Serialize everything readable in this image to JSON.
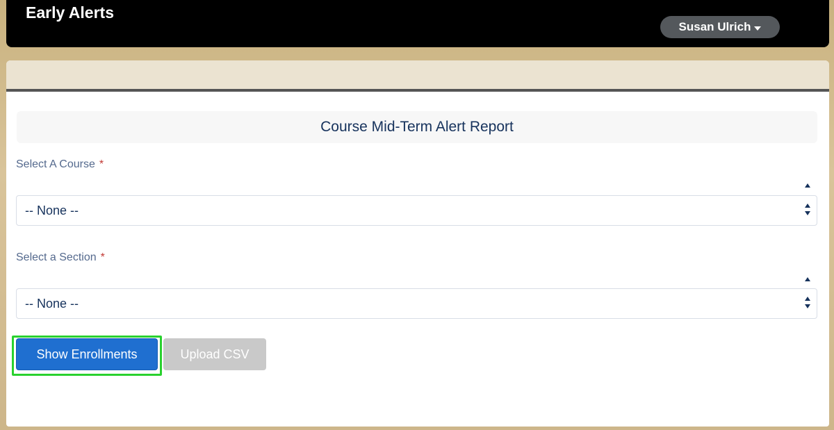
{
  "header": {
    "app_title": "Early Alerts",
    "user_name": "Susan Ulrich"
  },
  "report": {
    "title": "Course Mid-Term Alert Report"
  },
  "form": {
    "course": {
      "label": "Select A Course",
      "required_marker": "*",
      "selected": "-- None --"
    },
    "section": {
      "label": "Select a Section",
      "required_marker": "*",
      "selected": "-- None --"
    }
  },
  "actions": {
    "show_enrollments": "Show Enrollments",
    "upload_csv": "Upload CSV"
  },
  "colors": {
    "primary_button": "#1f6fd0",
    "highlight_outline": "#29d12e",
    "required": "#c23934"
  }
}
